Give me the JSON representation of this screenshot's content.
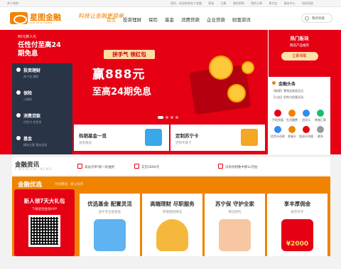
{
  "topbar": {
    "location": "苏宁易购",
    "links": [
      "您好，欢迎来到苏宁金融",
      "登录",
      "注册",
      "我的易购",
      "我的订单",
      "易付宝",
      "服务中心",
      "网站导航"
    ]
  },
  "header": {
    "logo_text": "星图金融",
    "logo_en": "STAR ATLAS FINANCE",
    "slogan": "科技让金融更简单",
    "nav": [
      "首页",
      "投资理财",
      "保险",
      "基金",
      "消费贷款",
      "企业贷款",
      "财富资讯"
    ],
    "search_placeholder": "我的财富"
  },
  "sidebar": {
    "promo_small": "80元新人礼",
    "promo_big": "任性付至高24期免息",
    "items": [
      {
        "title": "投资理财",
        "sub": "苏宁宝 理财"
      },
      {
        "title": "保险",
        "sub": "小微保"
      },
      {
        "title": "消费贷款",
        "sub": "任性付 任性贷"
      },
      {
        "title": "基金",
        "sub": "精选主题 基金定投"
      }
    ]
  },
  "banner": {
    "pill": "拼手气 领红包",
    "headline": "赢888元",
    "subline": "至高24期免息"
  },
  "promos": [
    {
      "title": "热销基金一览",
      "sub": "基金精选"
    },
    {
      "title": "定制苏宁卡",
      "sub": "定制专属卡"
    }
  ],
  "right_panel": {
    "hot_title": "热门板块",
    "hot_sub": "精选产品推荐",
    "hot_btn": "立即领取",
    "news_title": "金融头条",
    "news": [
      "【新规】零钱宝收益互比",
      "【公告】任性付优惠活动"
    ],
    "services": [
      "手机充值",
      "生活缴费",
      "信用卡",
      "转账汇款",
      "信用卡还款",
      "发福卡",
      "加油卡充值",
      "更多"
    ]
  },
  "finance_news": {
    "title": "金融资讯",
    "en": "FINANCIAL NEWS",
    "items": [
      "高返点单!新一轮抽奖",
      "又见2800点",
      "没有你想象中那么可怕"
    ]
  },
  "youxuan": {
    "title": "金融优选",
    "sub": "为您精选 · 省心投资",
    "cards": [
      {
        "title": "新人领7天大礼包",
        "sub": "下载星图金融APP"
      },
      {
        "title": "优选基金 配置灵活",
        "sub": "金牛奖主题基金"
      },
      {
        "title": "高端理财 尽职服务",
        "sub": "稳健理财精选"
      },
      {
        "title": "苏宁保 守护全家",
        "sub": "精选保险"
      },
      {
        "title": "享丰厚佣金",
        "sub": "推荐有奖"
      }
    ],
    "redpack_amount": "¥2000"
  }
}
